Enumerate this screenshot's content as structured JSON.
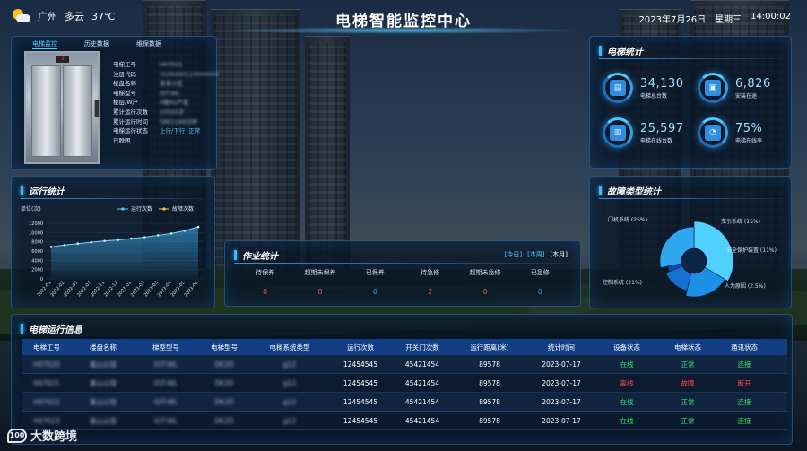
{
  "header": {
    "title": "电梯智能监控中心",
    "city": "广州",
    "weather": "多云",
    "temperature": "37℃",
    "date": "2023年7月26日",
    "weekday": "星期三",
    "time": "14:00:02"
  },
  "elevator_panel": {
    "tabs": [
      "电梯监控",
      "历史数据",
      "维保数据"
    ],
    "floor_indicator": "2",
    "info": [
      {
        "label": "电梯工号",
        "value": "H07021"
      },
      {
        "label": "注册代码",
        "value": "3100440110000000"
      },
      {
        "label": "楼盘名称",
        "value": "某某小区"
      },
      {
        "label": "电梯型号",
        "value": "IOT-WL"
      },
      {
        "label": "楼层/W户",
        "value": "5楼A1户室"
      },
      {
        "label": "累计运行次数",
        "value": "23555次"
      },
      {
        "label": "累计运行时间",
        "value": "5861198分钟"
      },
      {
        "label": "电梯运行状态",
        "value": "上行/下行",
        "extra": "正常"
      },
      {
        "label": "已脱困",
        "value": ""
      }
    ]
  },
  "elevator_stats": {
    "title": "电梯统计",
    "items": [
      {
        "value": "34,130",
        "label": "电梯总台数",
        "icon": "elevator-icon"
      },
      {
        "value": "6,826",
        "label": "安装在途",
        "icon": "install-icon"
      },
      {
        "value": "25,597",
        "label": "电梯在线台数",
        "icon": "online-icon"
      },
      {
        "value": "75%",
        "label": "电梯在线率",
        "icon": "rate-icon"
      }
    ]
  },
  "run_stats": {
    "title": "运行统计",
    "unit_label": "单位(次)",
    "legend": [
      "运行次数",
      "故障次数"
    ],
    "legend_colors": [
      "#5ac8ff",
      "#ffcc33"
    ]
  },
  "chart_data": {
    "type": "area",
    "title": "运行统计",
    "ylabel": "单位(次)",
    "ylim": [
      0,
      12000
    ],
    "yticks": [
      0,
      2000,
      4000,
      6000,
      8000,
      10000,
      12000
    ],
    "categories": [
      "2022-01",
      "2022-02",
      "2022-03",
      "2022-07",
      "2022-11",
      "2022-12",
      "2023-01",
      "2023-02",
      "2023-03",
      "2023-04",
      "2023-05",
      "2023-06"
    ],
    "series": [
      {
        "name": "运行次数",
        "values": [
          6900,
          7300,
          7600,
          7900,
          8200,
          8400,
          8700,
          9000,
          9400,
          9800,
          10400,
          11200
        ]
      }
    ]
  },
  "job_stats": {
    "title": "作业统计",
    "tabs": [
      "[今日]",
      "[本周]",
      "[本月]"
    ],
    "columns": [
      {
        "label": "待保养",
        "value": "0",
        "color": "#ff4a4a"
      },
      {
        "label": "超期未保养",
        "value": "0",
        "color": "#ff4a4a"
      },
      {
        "label": "已保养",
        "value": "0",
        "color": "#3f8fff"
      },
      {
        "label": "待急修",
        "value": "2",
        "color": "#ff4a4a"
      },
      {
        "label": "超期未急修",
        "value": "0",
        "color": "#ff4a4a"
      },
      {
        "label": "已急修",
        "value": "0",
        "color": "#3f8fff"
      }
    ]
  },
  "fault_stats": {
    "title": "故障类型统计",
    "slices": [
      {
        "label": "门机系统",
        "pct": "(25%)",
        "value": 25,
        "color": "#4fd0ff"
      },
      {
        "label": "曳引系统",
        "pct": "(15%)",
        "value": 15,
        "color": "#1c8fe6"
      },
      {
        "label": "安全保护装置",
        "pct": "(11%)",
        "value": 11,
        "color": "#1570d0"
      },
      {
        "label": "人为原因",
        "pct": "(2.5%)",
        "value": 2.5,
        "color": "#0d4fa8"
      },
      {
        "label": "控制系统",
        "pct": "(21%)",
        "value": 21,
        "color": "#2fa7ef"
      }
    ]
  },
  "status_table": {
    "title": "电梯运行信息",
    "headers": [
      "电梯工号",
      "楼盘名称",
      "梯型型号",
      "电梯型号",
      "电梯系统类型",
      "运行次数",
      "开关门次数",
      "运行距离(米)",
      "统计时间",
      "设备状态",
      "电梯状态",
      "通讯状态"
    ],
    "rows": [
      [
        "H07020",
        "某山公馆",
        "IOT-WL",
        "DK2D",
        "g12",
        "12454545",
        "45421454",
        "89578",
        "2023-07-17",
        "在线",
        "正常",
        "连接"
      ],
      [
        "H07021",
        "某山公馆",
        "IOT-WL",
        "DK2D",
        "g12",
        "12454545",
        "45421454",
        "89578",
        "2023-07-17",
        "离线",
        "故障",
        "断开"
      ],
      [
        "H07022",
        "某山公馆",
        "IOT-WL",
        "DK2D",
        "g12",
        "12454545",
        "45421454",
        "89578",
        "2023-07-17",
        "在线",
        "正常",
        "连接"
      ],
      [
        "H07023",
        "某山公馆",
        "IOT-WL",
        "DK2D",
        "g12",
        "12454545",
        "45421454",
        "89578",
        "2023-07-17",
        "在线",
        "正常",
        "连接"
      ]
    ]
  },
  "watermark": {
    "logo": "100",
    "text": "大数跨境"
  }
}
